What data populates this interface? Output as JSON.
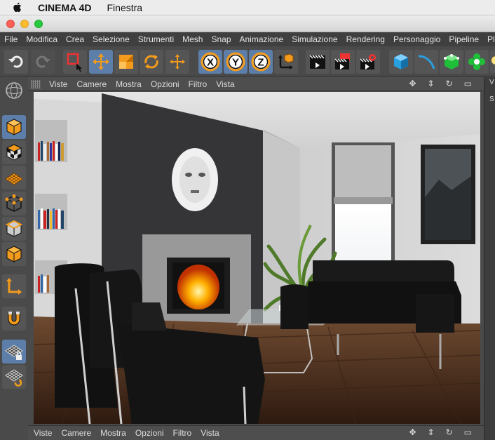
{
  "system_bar": {
    "app_name": "CINEMA 4D",
    "menu": "Finestra"
  },
  "menu": {
    "items": [
      "File",
      "Modifica",
      "Crea",
      "Selezione",
      "Strumenti",
      "Mesh",
      "Snap",
      "Animazione",
      "Simulazione",
      "Rendering",
      "Personaggio",
      "Pipeline",
      "Plugi"
    ]
  },
  "viewport": {
    "menu": [
      "Viste",
      "Camere",
      "Mostra",
      "Opzioni",
      "Filtro",
      "Vista"
    ]
  },
  "bottom_panel": {
    "menu": [
      "Viste",
      "Camere",
      "Mostra",
      "Opzioni",
      "Filtro",
      "Vista"
    ]
  },
  "right_panel": {
    "labels": [
      "V",
      "S"
    ]
  },
  "colors": {
    "accent_orange": "#f29b1d",
    "selected_blue": "#5d7ea8",
    "panel_gray": "#4a4a4a"
  },
  "icons": {
    "toolbar": [
      "undo-icon",
      "redo-icon",
      "live-selection-icon",
      "move-icon",
      "scale-icon",
      "rotate-icon",
      "transform-icon",
      "x-axis-lock-icon",
      "y-axis-lock-icon",
      "z-axis-lock-icon",
      "coordinate-system-icon",
      "render-view-icon",
      "render-picture-queue-icon",
      "render-settings-icon",
      "cube-primitive-icon",
      "spline-pen-icon",
      "generator-icon",
      "mograph-cloner-icon",
      "light-bulb-icon"
    ],
    "sidebar": [
      "make-editable-icon",
      "model-mode-icon",
      "texture-mode-icon",
      "workplane-icon",
      "points-mode-icon",
      "edges-mode-icon",
      "polygons-mode-icon",
      "axis-mode-icon",
      "snap-magnet-icon",
      "lock-workplane-icon",
      "rotate-workplane-icon"
    ]
  }
}
